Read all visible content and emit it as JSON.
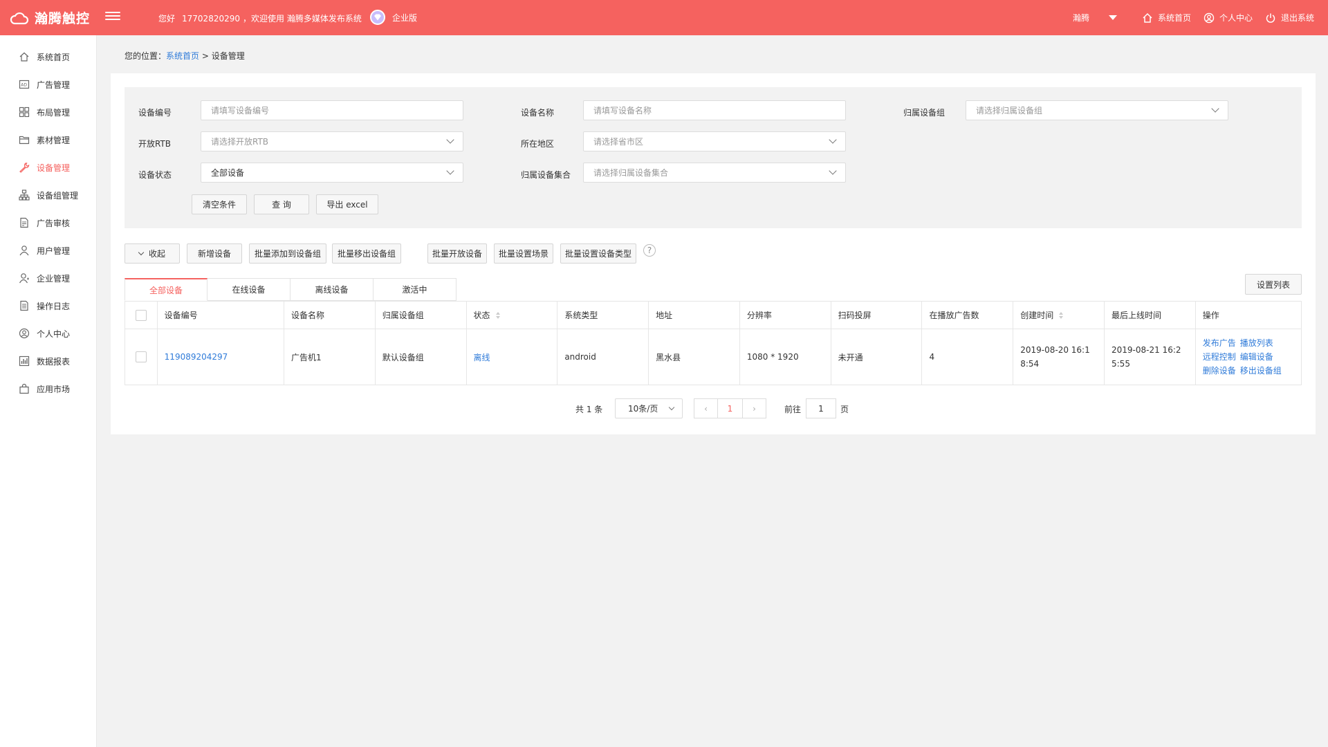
{
  "header": {
    "brand": "瀚腾触控",
    "greeting": "您好",
    "phone": "17702820290",
    "welcome_text": "，欢迎使用 瀚腾多媒体发布系统",
    "edition": "企业版",
    "user_name": "瀚腾",
    "home_label": "系统首页",
    "profile_label": "个人中心",
    "logout_label": "退出系统",
    "color": "#f5625f"
  },
  "sidebar": {
    "items": [
      {
        "label": "系统首页",
        "icon": "home-icon"
      },
      {
        "label": "广告管理",
        "icon": "ad-icon"
      },
      {
        "label": "布局管理",
        "icon": "grid-icon"
      },
      {
        "label": "素材管理",
        "icon": "folder-icon"
      },
      {
        "label": "设备管理",
        "icon": "wrench-icon",
        "active": true
      },
      {
        "label": "设备组管理",
        "icon": "hierarchy-icon"
      },
      {
        "label": "广告审核",
        "icon": "review-icon"
      },
      {
        "label": "用户管理",
        "icon": "user-icon"
      },
      {
        "label": "企业管理",
        "icon": "company-icon"
      },
      {
        "label": "操作日志",
        "icon": "log-icon"
      },
      {
        "label": "个人中心",
        "icon": "profile-icon"
      },
      {
        "label": "数据报表",
        "icon": "report-icon"
      },
      {
        "label": "应用市场",
        "icon": "bag-icon"
      }
    ]
  },
  "breadcrumb": {
    "prefix": "您的位置：",
    "home": "系统首页",
    "sep": ">",
    "current": "设备管理"
  },
  "filter": {
    "device_no_label": "设备编号",
    "device_no_placeholder": "请填写设备编号",
    "device_name_label": "设备名称",
    "device_name_placeholder": "请填写设备名称",
    "group_label": "归属设备组",
    "group_placeholder": "请选择归属设备组",
    "rtb_label": "开放RTB",
    "rtb_placeholder": "请选择开放RTB",
    "region_label": "所在地区",
    "region_placeholder": "请选择省市区",
    "status_label": "设备状态",
    "status_value": "全部设备",
    "collection_label": "归属设备集合",
    "collection_placeholder": "请选择归属设备集合",
    "clear_btn": "清空条件",
    "query_btn": "查 询",
    "export_btn": "导出 excel"
  },
  "toolbar": {
    "collapse": "收起",
    "add": "新增设备",
    "batch_add_group": "批量添加到设备组",
    "batch_remove_group": "批量移出设备组",
    "batch_open": "批量开放设备",
    "batch_scene": "批量设置场景",
    "batch_type": "批量设置设备类型",
    "help": "?",
    "column_settings": "设置列表"
  },
  "tabs": [
    "全部设备",
    "在线设备",
    "离线设备",
    "激活中"
  ],
  "table": {
    "headers": [
      "设备编号",
      "设备名称",
      "归属设备组",
      "状态",
      "系统类型",
      "地址",
      "分辨率",
      "扫码投屏",
      "在播放广告数",
      "创建时间",
      "最后上线时间",
      "操作"
    ],
    "rows": [
      {
        "device_no": "119089204297",
        "name": "广告机1",
        "group": "默认设备组",
        "status": "离线",
        "os": "android",
        "address": "黑水县",
        "resolution": "1080 * 1920",
        "scan": "未开通",
        "ad_count": "4",
        "created": "2019-08-20 16:18:54",
        "last_online": "2019-08-21 16:25:55",
        "ops": [
          "发布广告",
          "播放列表",
          "远程控制",
          "编辑设备",
          "删除设备",
          "移出设备组"
        ]
      }
    ]
  },
  "pager": {
    "total": "共 1 条",
    "page_size": "10条/页",
    "current": "1",
    "goto_label": "前往",
    "goto_value": "1",
    "unit": "页"
  }
}
